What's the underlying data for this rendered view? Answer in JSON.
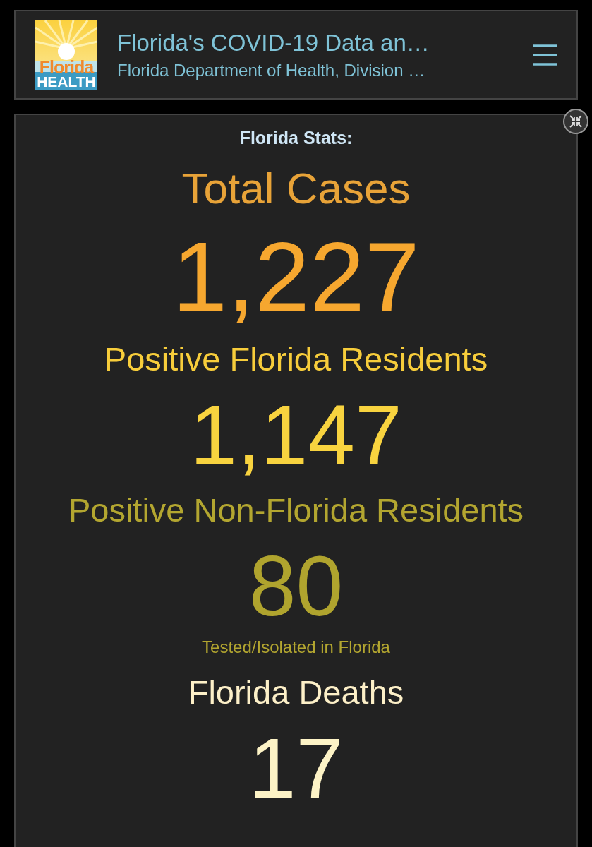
{
  "header": {
    "logo": {
      "line1": "Florida",
      "line2": "HEALTH"
    },
    "title": "Florida's COVID-19 Data an…",
    "subtitle": "Florida Department of Health, Division …"
  },
  "stats": [
    {
      "kind": "heading",
      "text": "Florida Stats:",
      "color": "#cfe6f5"
    },
    {
      "kind": "title",
      "text": "Total Cases",
      "color": "#e8a338"
    },
    {
      "kind": "big-value",
      "text": "1,227",
      "color": "#f6a72f"
    },
    {
      "kind": "label",
      "text": "Positive Florida Residents",
      "color": "#f7cd3b"
    },
    {
      "kind": "value",
      "text": "1,147",
      "color": "#f8d33f"
    },
    {
      "kind": "label",
      "text": "Positive Non-Florida Residents",
      "color": "#b3a630"
    },
    {
      "kind": "value",
      "text": "80",
      "color": "#b0a42e"
    },
    {
      "kind": "note",
      "text": "Tested/Isolated in Florida",
      "color": "#b3a630"
    },
    {
      "kind": "label",
      "text": "Florida Deaths",
      "color": "#fdf0c8"
    },
    {
      "kind": "value",
      "text": "17",
      "color": "#fdf3c6"
    }
  ]
}
